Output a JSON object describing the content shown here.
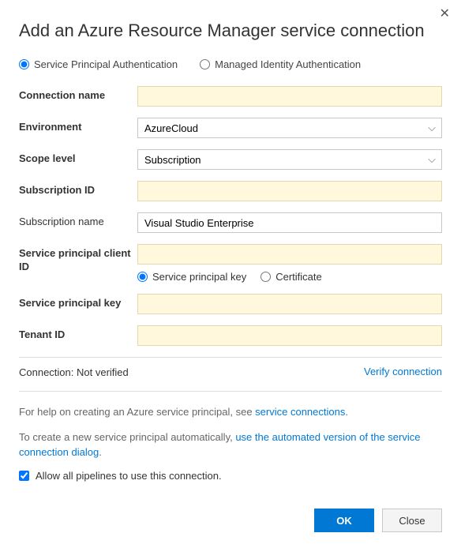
{
  "title": "Add an Azure Resource Manager service connection",
  "auth": {
    "spa_label": "Service Principal Authentication",
    "mia_label": "Managed Identity Authentication"
  },
  "labels": {
    "connection_name": "Connection name",
    "environment": "Environment",
    "scope_level": "Scope level",
    "subscription_id": "Subscription ID",
    "subscription_name": "Subscription name",
    "sp_client_id": "Service principal client ID",
    "sp_key": "Service principal key",
    "tenant_id": "Tenant ID"
  },
  "values": {
    "connection_name": "",
    "environment": "AzureCloud",
    "scope_level": "Subscription",
    "subscription_id": "",
    "subscription_name": "Visual Studio Enterprise",
    "sp_client_id": "",
    "sp_key": "",
    "tenant_id": ""
  },
  "cred_type": {
    "key_label": "Service principal key",
    "cert_label": "Certificate"
  },
  "verify": {
    "status_label": "Connection:",
    "status_value": "Not verified",
    "link": "Verify connection"
  },
  "help": {
    "line1_pre": "For help on creating an Azure service principal, see ",
    "line1_link": "service connections",
    "line1_post": ".",
    "line2_pre": "To create a new service principal automatically, ",
    "line2_link": "use the automated version of the service connection dialog",
    "line2_post": "."
  },
  "allow_label": "Allow all pipelines to use this connection.",
  "buttons": {
    "ok": "OK",
    "close": "Close"
  }
}
